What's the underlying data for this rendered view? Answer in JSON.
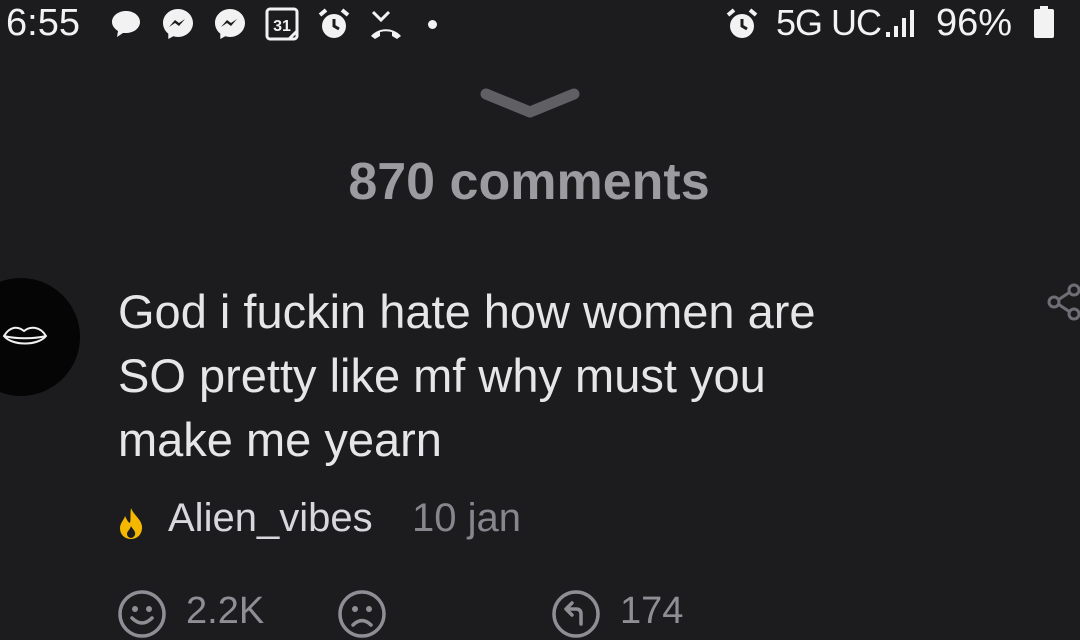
{
  "status_bar": {
    "time": "6:55",
    "calendar_day": "31",
    "network": "5G UC",
    "battery": "96%",
    "icons": [
      "chat-bubble-icon",
      "messenger-icon",
      "messenger-icon",
      "calendar-icon",
      "alarm-icon",
      "missed-call-icon",
      "alarm-icon",
      "signal-icon",
      "battery-icon"
    ]
  },
  "sheet": {
    "collapse_icon": "chevron-down-icon",
    "title": "870 comments"
  },
  "comment": {
    "text_lines": [
      "God i fuckin hate how women are",
      "SO pretty like mf why must you",
      "make me yearn"
    ],
    "author": "Alien_vibes",
    "date": "10 jan",
    "author_badge_icon": "flame-icon",
    "share_icon": "share-icon",
    "actions": {
      "like_count": "2.2K",
      "like_icon": "smiley-icon",
      "dislike_icon": "sad-face-icon",
      "reply_count": "174",
      "reply_icon": "reply-icon"
    }
  },
  "colors": {
    "background": "#1c1c1f",
    "title": "#9b9ba0",
    "body_text": "#e6e6e8",
    "muted": "#86868c",
    "flame": "#f5b700"
  }
}
